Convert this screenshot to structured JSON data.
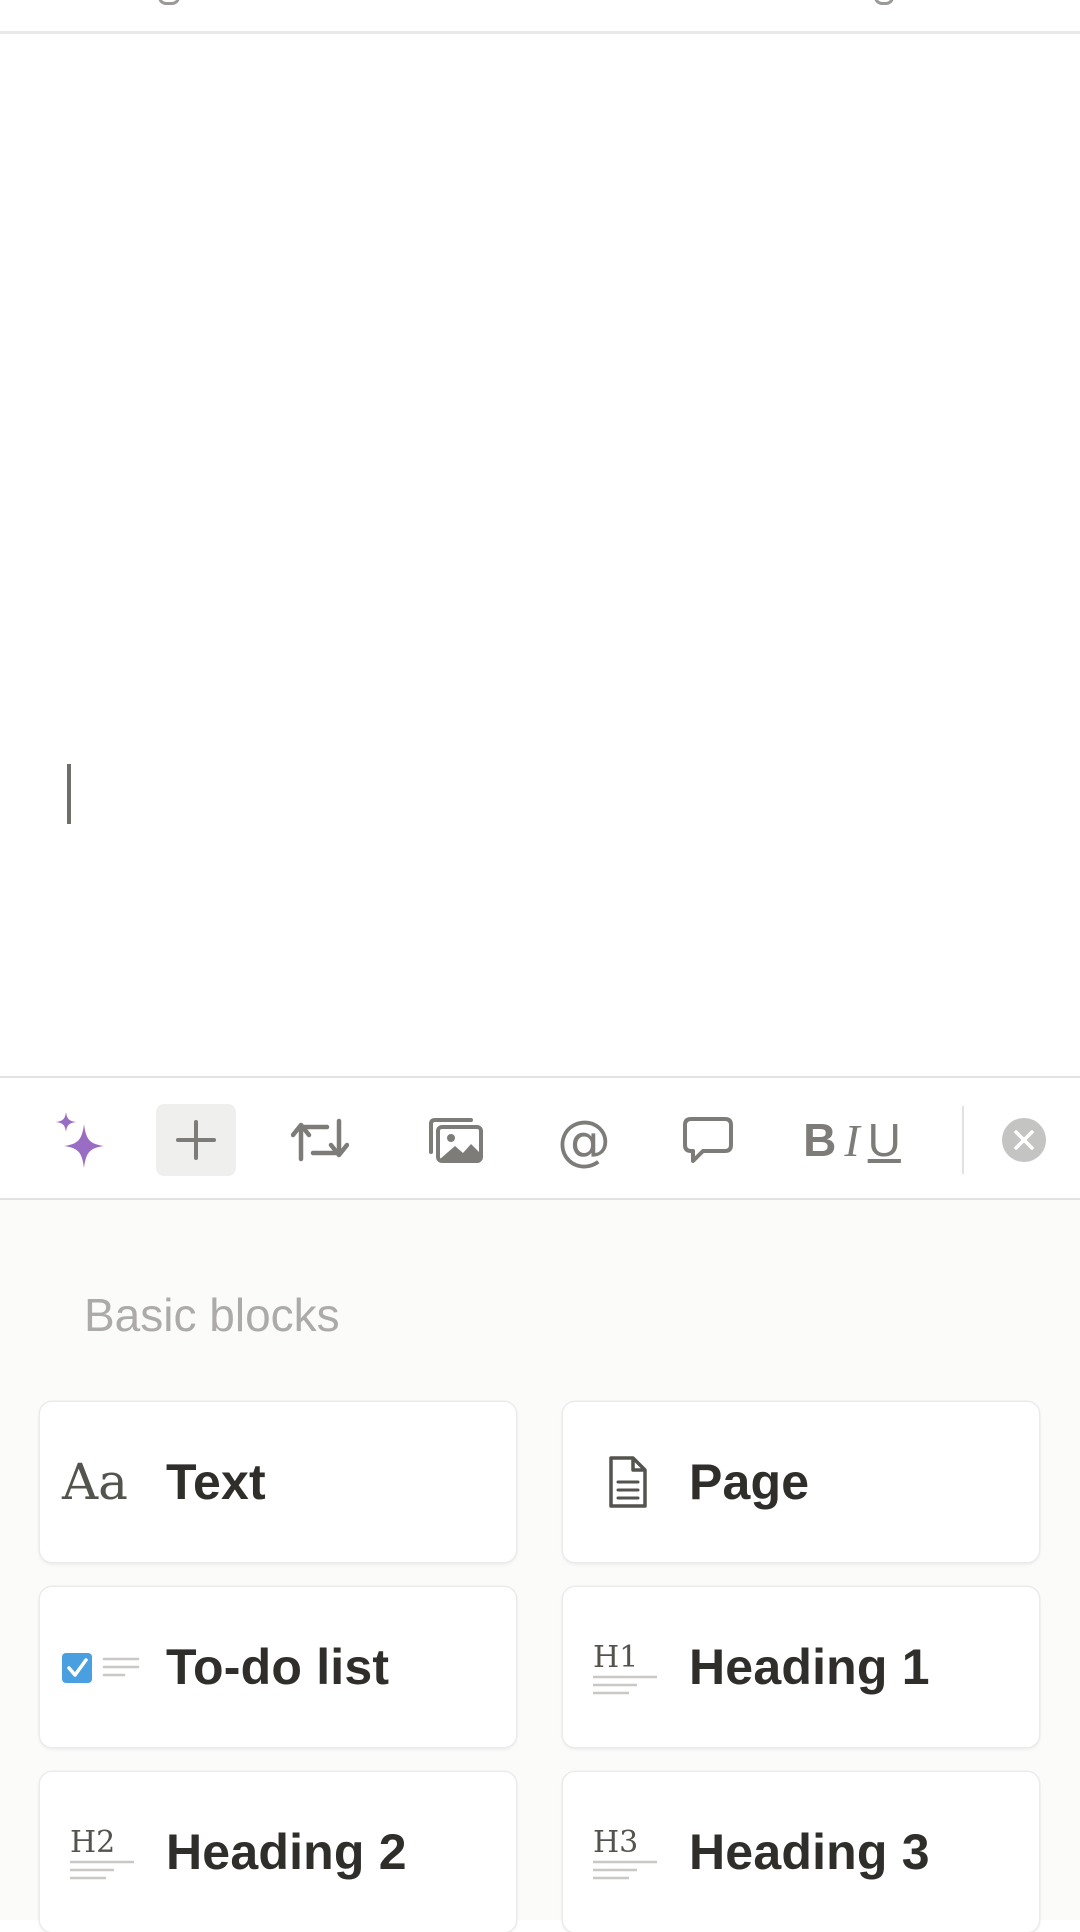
{
  "toolbar": {
    "items": [
      {
        "icon": "sparkle-icon"
      },
      {
        "icon": "plus-icon"
      },
      {
        "icon": "turn-into-icon"
      },
      {
        "icon": "media-icon"
      },
      {
        "icon": "at-mention-icon",
        "glyph": "@"
      },
      {
        "icon": "comment-icon"
      },
      {
        "icon": "text-format-icon",
        "bold": "B",
        "italic": "I",
        "underline": "U"
      },
      {
        "icon": "close-icon"
      }
    ],
    "accent_color": "#9a6dc4"
  },
  "menu": {
    "section_title": "Basic blocks",
    "blocks": [
      {
        "label": "Text",
        "icon": "text-aa-icon",
        "icon_text": "Aa"
      },
      {
        "label": "Page",
        "icon": "page-icon"
      },
      {
        "label": "To-do list",
        "icon": "todo-checkbox-icon",
        "checkbox_color": "#4a9fe0"
      },
      {
        "label": "Heading 1",
        "icon": "heading-1-icon",
        "icon_text": "H1"
      },
      {
        "label": "Heading 2",
        "icon": "heading-2-icon",
        "icon_text": "H2"
      },
      {
        "label": "Heading 3",
        "icon": "heading-3-icon",
        "icon_text": "H3"
      }
    ]
  }
}
